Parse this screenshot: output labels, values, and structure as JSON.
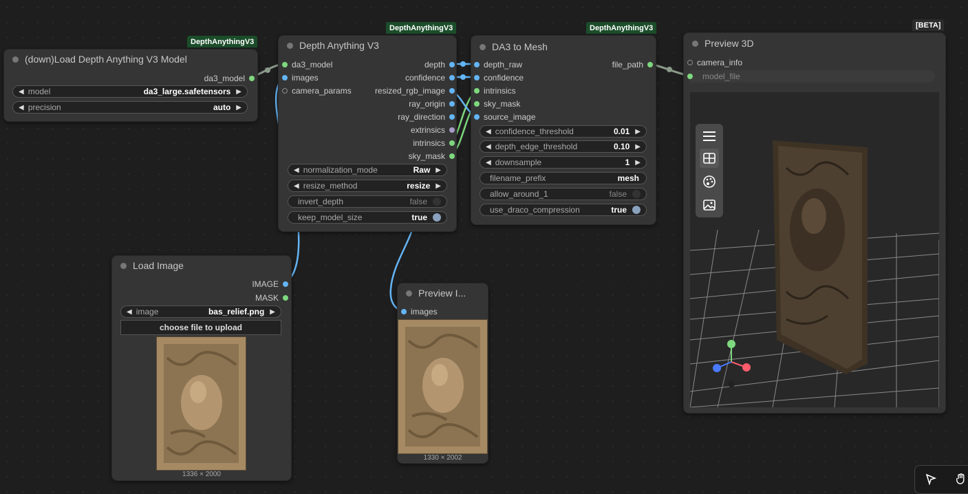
{
  "nodes": {
    "load_model": {
      "badge": "DepthAnythingV3",
      "title": "(down)Load Depth Anything V3 Model",
      "output": "da3_model",
      "widgets": [
        {
          "label": "model",
          "value": "da3_large.safetensors"
        },
        {
          "label": "precision",
          "value": "auto"
        }
      ]
    },
    "depth_anything": {
      "badge": "DepthAnythingV3",
      "title": "Depth Anything V3",
      "inputs": [
        "da3_model",
        "images",
        "camera_params"
      ],
      "outputs": [
        "depth",
        "confidence",
        "resized_rgb_image",
        "ray_origin",
        "ray_direction",
        "extrinsics",
        "intrinsics",
        "sky_mask"
      ],
      "widgets": [
        {
          "label": "normalization_mode",
          "value": "Raw"
        },
        {
          "label": "resize_method",
          "value": "resize"
        },
        {
          "label": "invert_depth",
          "value": "false"
        },
        {
          "label": "keep_model_size",
          "value": "true"
        }
      ]
    },
    "da3_mesh": {
      "badge": "DepthAnythingV3",
      "title": "DA3 to Mesh",
      "inputs": [
        "depth_raw",
        "confidence",
        "intrinsics",
        "sky_mask",
        "source_image"
      ],
      "output": "file_path",
      "widgets": [
        {
          "label": "confidence_threshold",
          "value": "0.01"
        },
        {
          "label": "depth_edge_threshold",
          "value": "0.10"
        },
        {
          "label": "downsample",
          "value": "1"
        },
        {
          "label": "filename_prefix",
          "value": "mesh"
        },
        {
          "label": "allow_around_1",
          "value": "false"
        },
        {
          "label": "use_draco_compression",
          "value": "true"
        }
      ]
    },
    "preview3d": {
      "badge": "[BETA]",
      "title": "Preview 3D",
      "inputs": [
        "camera_info",
        "model_file"
      ]
    },
    "load_image": {
      "title": "Load Image",
      "outputs": [
        "IMAGE",
        "MASK"
      ],
      "widget": {
        "label": "image",
        "value": "bas_relief.png"
      },
      "upload": "choose file to upload",
      "caption": "1336 × 2000"
    },
    "preview_image": {
      "title": "Preview I...",
      "input": "images",
      "caption": "1330 × 2002"
    }
  },
  "colors": {
    "badge": "#1b4d2a",
    "image_pin": "#64b5f6",
    "model_pin": "#7ed87e",
    "node_bg": "#353535",
    "canvas_bg": "#1e1e1e"
  },
  "icons": [
    "menu-icon",
    "grid-icon",
    "palette-icon",
    "image-icon",
    "pointer-icon",
    "hand-icon"
  ]
}
